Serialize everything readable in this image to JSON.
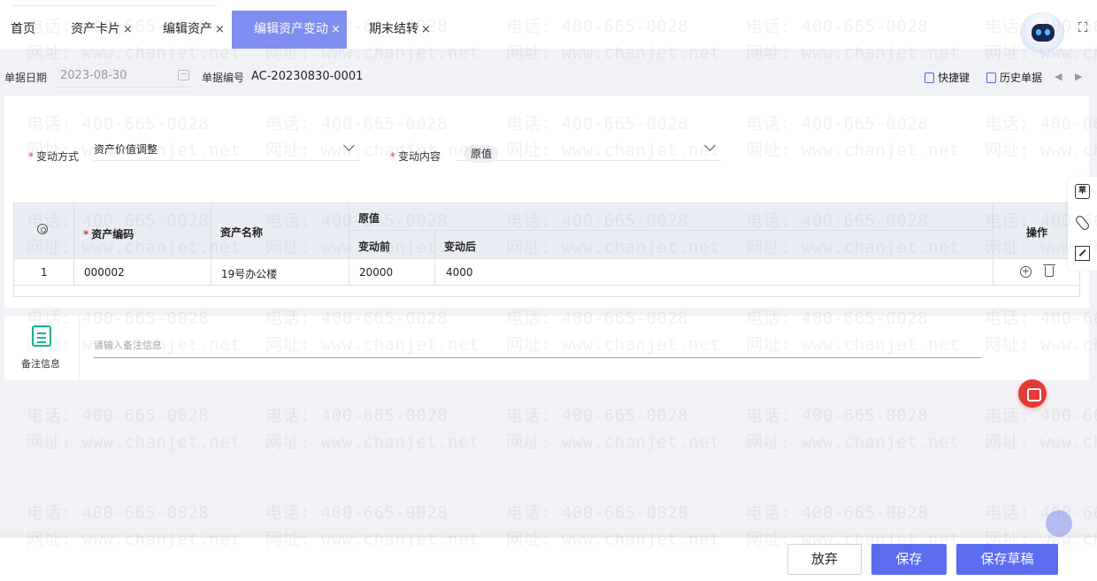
{
  "tabs": [
    {
      "label": "首页"
    },
    {
      "label": "资产卡片"
    },
    {
      "label": "编辑资产"
    },
    {
      "label": "编辑资产变动"
    },
    {
      "label": "期末结转"
    }
  ],
  "tab_close_glyph": "×",
  "doc": {
    "date_label": "单据日期",
    "date_value": "2023-08-30",
    "number_label": "单据编号",
    "number_value": "AC-20230830-0001",
    "shortcut_label": "快捷键",
    "history_label": "历史单据",
    "prev_icon": "◀",
    "next_icon": "▶"
  },
  "form": {
    "change_method_label": "变动方式",
    "change_method_value": "资产价值调整",
    "change_content_label": "变动内容",
    "change_content_chip": "原值"
  },
  "table": {
    "headers": {
      "asset_code": "资产编码",
      "asset_name": "资产名称",
      "group": "原值",
      "before": "变动前",
      "after": "变动后",
      "actions": "操作"
    },
    "rows": [
      {
        "index": "1",
        "asset_code": "000002",
        "asset_name": "19号办公楼",
        "before": "20000",
        "after": "4000"
      }
    ]
  },
  "remark": {
    "label": "备注信息",
    "placeholder": "请输入备注信息"
  },
  "sidetools": {
    "draft_icon_text": "草"
  },
  "footer": {
    "discard_label": "放弃",
    "save_label": "保存",
    "save_draft_label": "保存草稿"
  },
  "watermark": {
    "phone": "电话: 400-665-0028",
    "site": "网址: www.chanjet.net"
  },
  "colors": {
    "accent": "#5b6cf0",
    "active_tab": "#7f8ef0",
    "required": "#e13b2f",
    "red_button": "#e23b38"
  },
  "icons": [
    "calendar-icon",
    "keyboard-icon",
    "history-icon",
    "settings-icon",
    "add-icon",
    "delete-icon",
    "remark-icon",
    "draft-icon",
    "attachment-icon",
    "expand-icon",
    "fullscreen-icon",
    "robot-assistant-icon",
    "message-icon"
  ]
}
